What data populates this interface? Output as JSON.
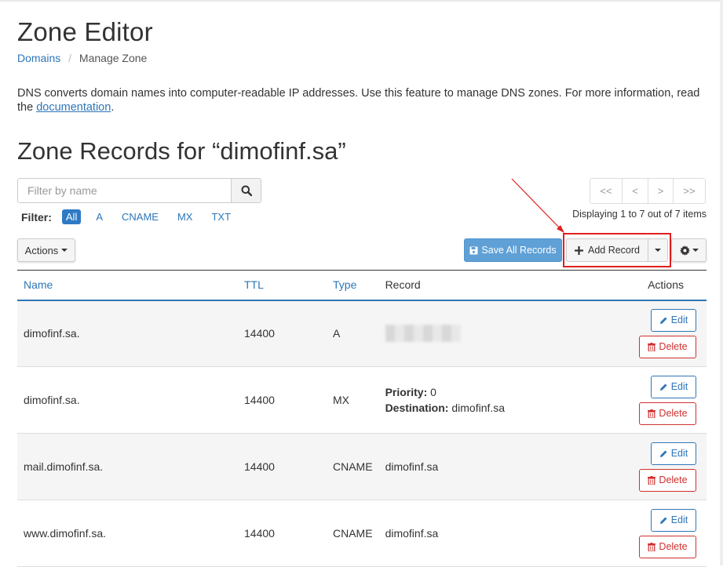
{
  "page": {
    "title": "Zone Editor",
    "breadcrumb": {
      "link": "Domains",
      "separator": "/",
      "current": "Manage Zone"
    },
    "description_text": "DNS converts domain names into computer-readable IP addresses. Use this feature to manage DNS zones. For more information, read the ",
    "description_link": "documentation",
    "description_end": ".",
    "zone_title": "Zone Records for “dimofinf.sa”"
  },
  "search": {
    "placeholder": "Filter by name",
    "icon": "search-icon"
  },
  "filter": {
    "label": "Filter:",
    "options": [
      "All",
      "A",
      "CNAME",
      "MX",
      "TXT"
    ],
    "selected": "All"
  },
  "pagination": {
    "buttons": [
      "<<",
      "<",
      ">",
      ">>"
    ],
    "displaying": "Displaying 1 to 7 out of 7 items"
  },
  "toolbar": {
    "actions_label": "Actions",
    "save_label": "Save All Records",
    "add_label": "Add Record",
    "gear_icon": "gear-icon"
  },
  "table": {
    "headers": {
      "name": "Name",
      "ttl": "TTL",
      "type": "Type",
      "record": "Record",
      "actions": "Actions"
    },
    "edit_label": "Edit",
    "delete_label": "Delete",
    "rows": [
      {
        "name": "dimofinf.sa.",
        "ttl": "14400",
        "type": "A",
        "record": ""
      },
      {
        "name": "dimofinf.sa.",
        "ttl": "14400",
        "type": "MX",
        "priority_label": "Priority:",
        "priority": "0",
        "destination_label": "Destination:",
        "destination": "dimofinf.sa"
      },
      {
        "name": "mail.dimofinf.sa.",
        "ttl": "14400",
        "type": "CNAME",
        "record": "dimofinf.sa"
      },
      {
        "name": "www.dimofinf.sa.",
        "ttl": "14400",
        "type": "CNAME",
        "record": "dimofinf.sa"
      }
    ]
  },
  "colors": {
    "link": "#2e76b8",
    "save_button": "#5fa0d6",
    "delete": "#d03030",
    "highlight": "#e02020"
  }
}
